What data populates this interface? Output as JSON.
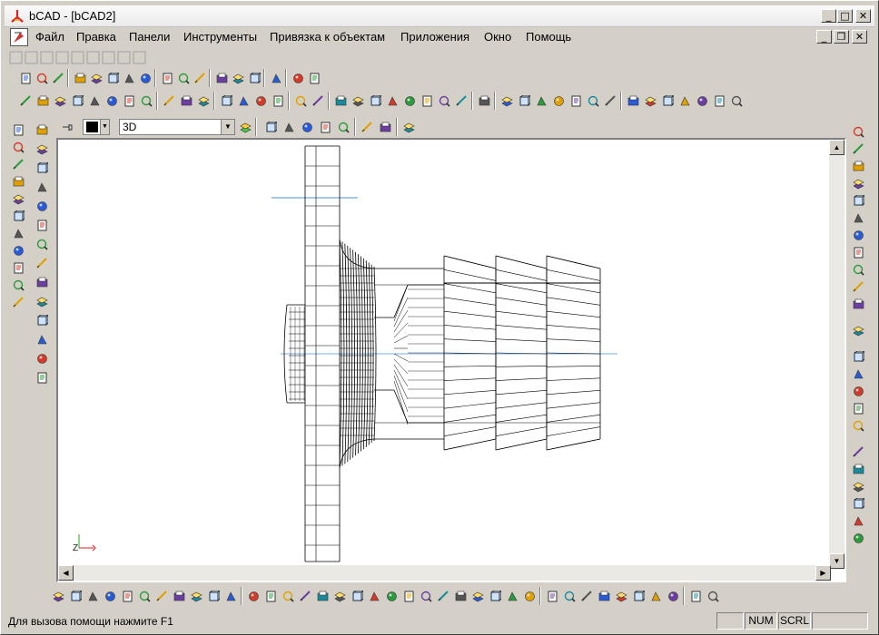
{
  "window": {
    "title": "bCAD - [bCAD2]",
    "minimize_glyph": "_",
    "maximize_glyph": "□",
    "close_glyph": "✕",
    "restore_glyph": "❐"
  },
  "menu": {
    "items": [
      "Файл",
      "Правка",
      "Панели",
      "Инструменты",
      "Привязка к объектам",
      "Приложения",
      "Окно",
      "Помощь"
    ]
  },
  "viewbar": {
    "view_mode": "3D"
  },
  "axis": {
    "x_label": "",
    "z_label": "Z"
  },
  "scroll": {
    "up": "▲",
    "down": "▼",
    "left": "◀",
    "right": "▶"
  },
  "status": {
    "help_text": "Для вызова помощи нажмите F1",
    "num": "NUM",
    "scrl": "SCRL"
  },
  "icons": {
    "toolbar1": [
      "new-icon",
      "new-doc-icon",
      "import-icon",
      "properties-icon",
      "open-icon",
      "save-icon",
      "save-as-icon",
      "save-all-icon",
      "select-icon",
      "move-icon",
      "snap-icon",
      "edit-icon",
      "copy-icon",
      "paste-icon",
      "print-icon",
      "undo-icon",
      "redo-icon"
    ],
    "toolbar2": [
      "zoom-icon",
      "zoom-in-icon",
      "zoom-window-icon",
      "pencil-icon",
      "eye-icon",
      "layer-icon",
      "hand-icon",
      "dimension-icon",
      "gear-icon",
      "layers-icon",
      "layer-stack-icon",
      "grid-icon",
      "ortho-icon",
      "table-icon",
      "picture-icon",
      "paint-icon",
      "brush-icon",
      "view-front-icon",
      "view-back-icon",
      "view-left-icon",
      "view-right-icon",
      "view-top-icon",
      "view-bottom-icon",
      "view-iso-icon",
      "view-ne-icon",
      "split-icon",
      "light-icon",
      "layers-a-icon",
      "layers-b-icon",
      "layers-c-icon",
      "layers-d-icon",
      "layers-e-icon",
      "layers-f-icon",
      "pan-icon",
      "zoom-real-icon",
      "orbit-icon",
      "rotate-icon",
      "stop-icon",
      "hammer-icon",
      "render-icon"
    ],
    "left_col1": [
      "line-icon",
      "circle-icon",
      "arc-icon",
      "polyline-icon",
      "rectangle-icon",
      "text-icon",
      "hatch-icon",
      "region-icon",
      "polygon-icon",
      "ellipse-icon",
      "point-icon"
    ],
    "left_col2": [
      "break-icon",
      "chamfer-icon",
      "fillet-icon",
      "offset-icon",
      "spline-icon",
      "curve-icon",
      "wave-icon",
      "scissors-icon",
      "block-icon",
      "layer-edit-icon",
      "extend-icon",
      "radius-icon",
      "trim-icon",
      "slope-icon"
    ],
    "right_col": [
      "dim-linear-icon",
      "dim-aligned-icon",
      "dim-angle-icon",
      "dim-radius-icon",
      "dim-diameter-icon",
      "dim-baseline-icon",
      "dim-center-icon",
      "dim-ordinate-icon",
      "dim-leader-icon",
      "dim-arc-icon",
      "dim-chain-icon",
      "list-icon",
      "xyz-icon",
      "stack-icon",
      "layers-3d-icon",
      "sheets-icon",
      "database-icon",
      "camera-icon",
      "light-pen-icon",
      "bulb-icon",
      "house-icon",
      "house-edit-icon",
      "house-3d-icon"
    ],
    "bottom": [
      "obj-1-icon",
      "obj-2-icon",
      "obj-3-icon",
      "obj-4-icon",
      "obj-5-icon",
      "align-icon",
      "grid-a-icon",
      "grid-b-icon",
      "grid-c-icon",
      "dots-icon",
      "copy-doc-icon",
      "cube-icon",
      "pyramid-icon",
      "wedge-icon",
      "sphere-icon",
      "cone-icon",
      "torus-icon",
      "cylinder-icon",
      "box-icon",
      "solid-a-icon",
      "solid-b-icon",
      "solid-c-icon",
      "solid-d-icon",
      "solid-e-icon",
      "solid-f-icon",
      "solid-g-icon",
      "solid-h-icon",
      "solid-i-icon",
      "material-a-icon",
      "material-b-icon",
      "material-c-icon",
      "material-d-icon",
      "material-e-icon",
      "material-f-icon",
      "material-g-icon",
      "material-h-icon",
      "flag-icon",
      "anchor-icon"
    ]
  },
  "colors": {
    "chrome": "#d4d0c8",
    "viewport_bg": "#ffffff",
    "model_stroke": "#000000",
    "axis_line": "#4a90d9"
  }
}
